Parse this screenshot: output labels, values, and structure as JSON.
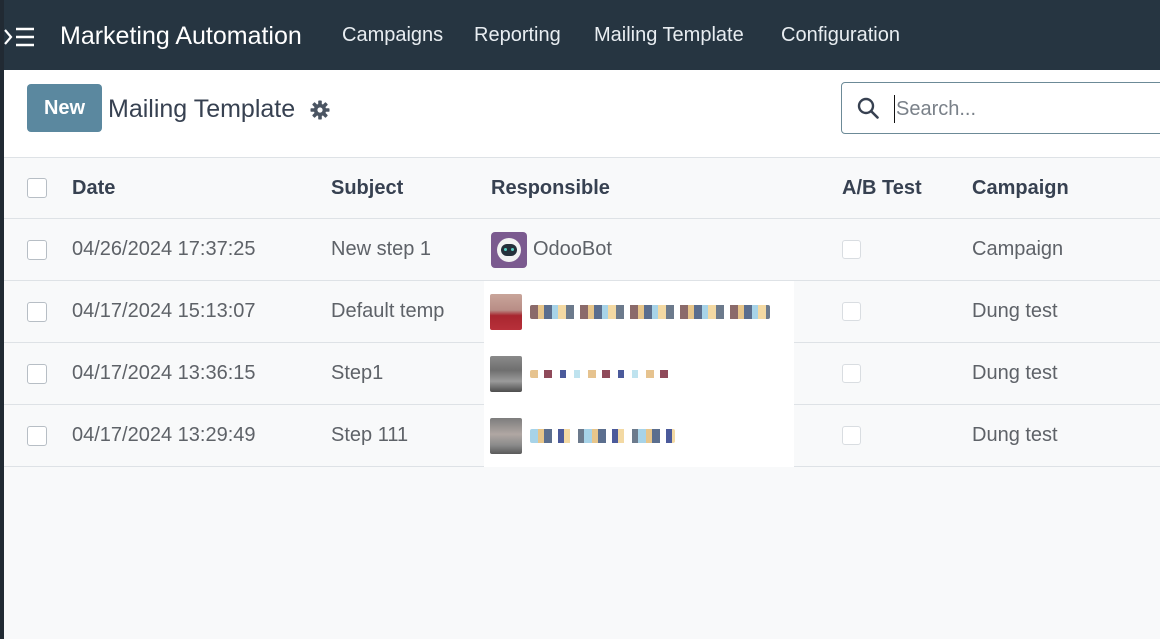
{
  "app": {
    "title": "Marketing Automation",
    "nav": [
      "Campaigns",
      "Reporting",
      "Mailing Template",
      "Configuration"
    ]
  },
  "control": {
    "new_label": "New",
    "breadcrumb": "Mailing Template",
    "search_placeholder": "Search..."
  },
  "table": {
    "columns": [
      "Date",
      "Subject",
      "Responsible",
      "A/B Test",
      "Campaign"
    ],
    "rows": [
      {
        "date": "04/26/2024 17:37:25",
        "subject": "New step 1",
        "responsible": "OdooBot",
        "ab_test": false,
        "campaign": "Campaign"
      },
      {
        "date": "04/17/2024 15:13:07",
        "subject": "Default temp",
        "responsible": "",
        "ab_test": false,
        "campaign": "Dung test"
      },
      {
        "date": "04/17/2024 13:36:15",
        "subject": "Step1",
        "responsible": "",
        "ab_test": false,
        "campaign": "Dung test"
      },
      {
        "date": "04/17/2024 13:29:49",
        "subject": "Step 111",
        "responsible": "",
        "ab_test": false,
        "campaign": "Dung test"
      }
    ]
  },
  "icons": {
    "menu": "menu-toggle-icon",
    "settings": "gear-icon",
    "search": "search-icon",
    "avatar": "odoobot-avatar-icon"
  },
  "colors": {
    "navbar": "#263541",
    "primary_button": "#5b889f",
    "background": "#f8f9fa"
  }
}
